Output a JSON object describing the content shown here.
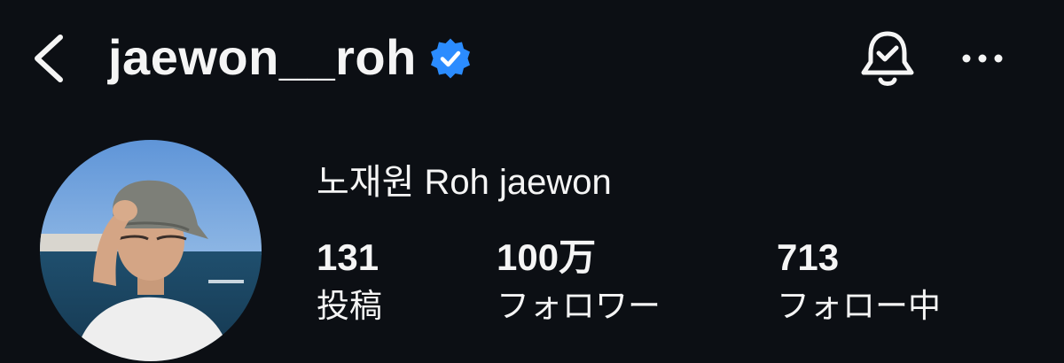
{
  "header": {
    "username": "jaewon__roh",
    "verified": true,
    "back_icon": "chevron-left-icon",
    "bell_icon": "bell-check-icon",
    "more_icon": "more-horizontal-icon"
  },
  "profile": {
    "display_name": "노재원 Roh jaewon",
    "avatar": "profile-photo"
  },
  "stats": {
    "posts": {
      "value": "131",
      "label": "投稿"
    },
    "followers": {
      "value": "100万",
      "label": "フォロワー"
    },
    "following": {
      "value": "713",
      "label": "フォロー中"
    }
  },
  "colors": {
    "background": "#0c0f14",
    "text": "#f5f5f5",
    "verified_badge": "#2b8cff"
  }
}
